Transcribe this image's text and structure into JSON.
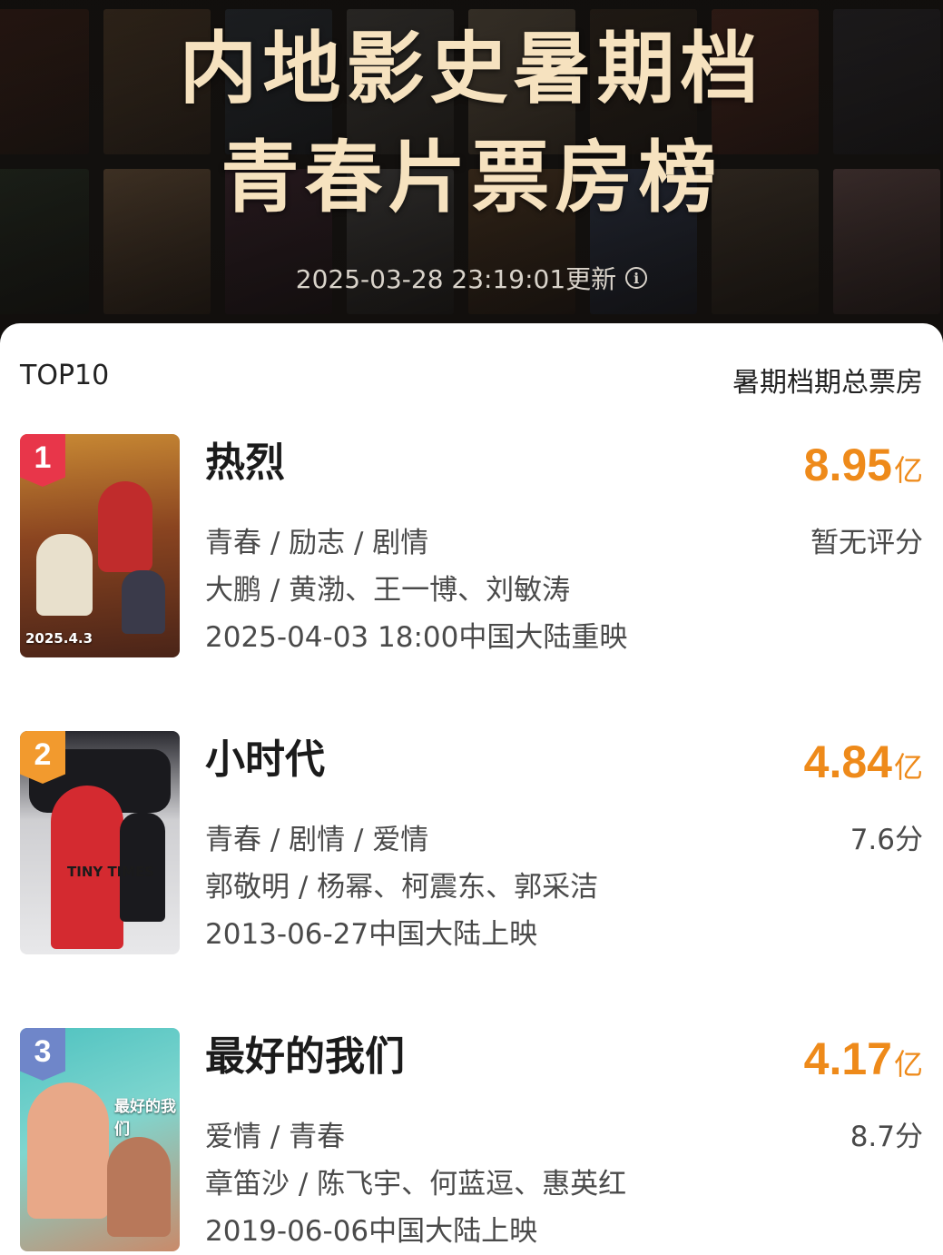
{
  "banner": {
    "title_line1": "内地影史暑期档",
    "title_line2": "青春片票房榜",
    "updated": "2025-03-28 23:19:01更新"
  },
  "list": {
    "left_label": "TOP10",
    "right_label": "暑期档期总票房",
    "items": [
      {
        "rank": "1",
        "title": "热烈",
        "gross_value": "8.95",
        "gross_unit": "亿",
        "genres": "青春 / 励志 / 剧情",
        "people": "大鹏 / 黄渤、王一博、刘敏涛",
        "release": "2025-04-03 18:00中国大陆重映",
        "score": "暂无评分",
        "poster_caption": "2025.4.3",
        "badge_color": "#e8364a"
      },
      {
        "rank": "2",
        "title": "小时代",
        "gross_value": "4.84",
        "gross_unit": "亿",
        "genres": "青春 / 剧情 / 爱情",
        "people": "郭敬明 / 杨幂、柯震东、郭采洁",
        "release": "2013-06-27中国大陆上映",
        "score": "7.6分",
        "poster_caption": "TINY TIMES",
        "badge_color": "#f29a2e"
      },
      {
        "rank": "3",
        "title": "最好的我们",
        "gross_value": "4.17",
        "gross_unit": "亿",
        "genres": "爱情 / 青春",
        "people": "章笛沙 / 陈飞宇、何蓝逗、惠英红",
        "release": "2019-06-06中国大陆上映",
        "score": "8.7分",
        "poster_caption": "最好的我们",
        "badge_color": "#6f86c9"
      }
    ]
  },
  "colors": {
    "accent_gross": "#ee8a1a",
    "banner_title": "#f6e2bf"
  },
  "icons": {
    "update_info": "info-circle-icon"
  }
}
